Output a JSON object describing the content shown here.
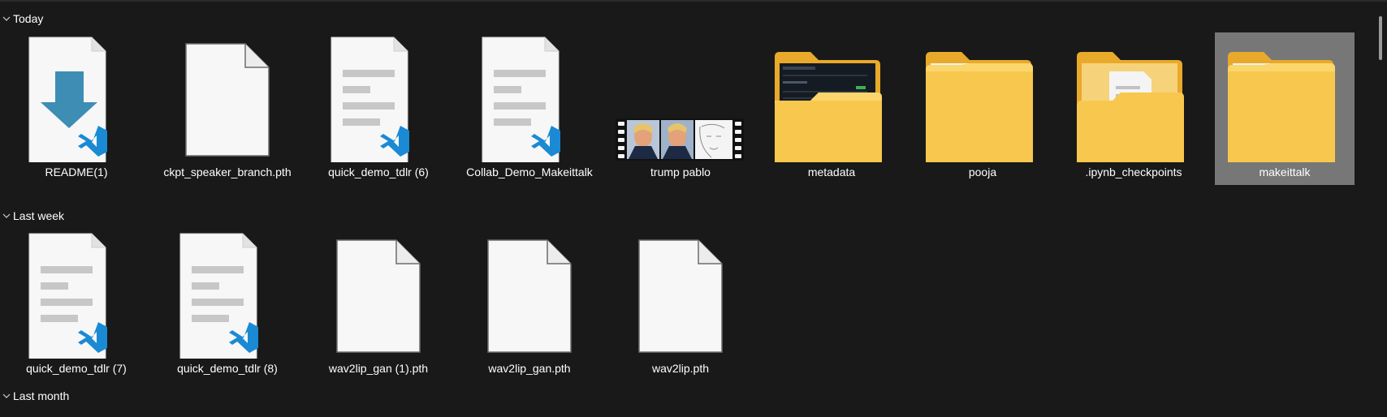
{
  "groups": [
    {
      "label": "Today",
      "items": [
        {
          "name": "README(1)",
          "icon": "vscode-download-file-icon"
        },
        {
          "name": "ckpt_speaker_branch.pth",
          "icon": "blank-file-icon"
        },
        {
          "name": "quick_demo_tdlr (6)",
          "icon": "vscode-text-file-icon"
        },
        {
          "name": "Collab_Demo_Makeittalk",
          "icon": "vscode-text-file-icon"
        },
        {
          "name": "trump pablo",
          "icon": "video-thumbnail-icon"
        },
        {
          "name": "metadata",
          "icon": "folder-screenshot-icon"
        },
        {
          "name": "pooja",
          "icon": "folder-icon"
        },
        {
          "name": ".ipynb_checkpoints",
          "icon": "folder-with-file-icon"
        },
        {
          "name": "makeittalk",
          "icon": "folder-icon",
          "selected": true
        }
      ]
    },
    {
      "label": "Last week",
      "items": [
        {
          "name": "quick_demo_tdlr (7)",
          "icon": "vscode-text-file-icon"
        },
        {
          "name": "quick_demo_tdlr (8)",
          "icon": "vscode-text-file-icon"
        },
        {
          "name": "wav2lip_gan (1).pth",
          "icon": "blank-file-icon"
        },
        {
          "name": "wav2lip_gan.pth",
          "icon": "blank-file-icon"
        },
        {
          "name": "wav2lip.pth",
          "icon": "blank-file-icon"
        }
      ]
    },
    {
      "label": "Last month",
      "items": []
    }
  ],
  "colors": {
    "background": "#191919",
    "selection": "#777777",
    "folder": "#f7c03a",
    "vscode_blue": "#1a8ad4",
    "download_arrow": "#3d8db5"
  }
}
